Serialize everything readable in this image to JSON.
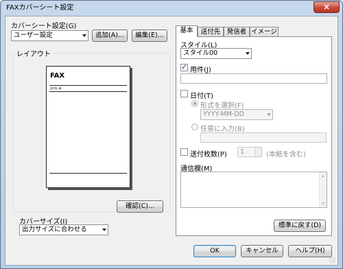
{
  "window": {
    "title": "FAXカバーシート設定",
    "close_icon": "×"
  },
  "cover_setting": {
    "label": "カバーシート設定(G)",
    "value": "ユーザー設定",
    "add_button": "追加(A)...",
    "edit_button": "編集(E)..."
  },
  "layout": {
    "group_title": "レイアウト",
    "preview": {
      "fax_text": "FAX",
      "line_text": "送付先: 様"
    },
    "confirm_button": "確認(C)..."
  },
  "cover_size": {
    "label": "カバーサイズ(I)",
    "value": "出力サイズに合わせる"
  },
  "tabs": [
    {
      "label": "基本",
      "active": true
    },
    {
      "label": "送付先",
      "active": false
    },
    {
      "label": "発信者",
      "active": false
    },
    {
      "label": "イメージ",
      "active": false
    }
  ],
  "basic": {
    "style_label": "スタイル(L)",
    "style_value": "スタイル00",
    "subject_label": "用件(J)",
    "subject_value": "",
    "date_label": "日付(T)",
    "date_format_label": "形式を選択(F)",
    "date_format_value": "YYYY-MM-DD",
    "date_custom_label": "任意に入力(B)",
    "pages_label": "送付枚数(P)",
    "pages_value": "1",
    "pages_note": "(本紙を含む)",
    "comment_label": "通信欄(M)",
    "default_button": "標準に戻す(D)"
  },
  "footer": {
    "ok": "OK",
    "cancel": "キャンセル",
    "help": "ヘルプ(H)"
  }
}
